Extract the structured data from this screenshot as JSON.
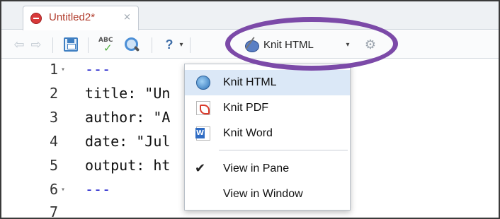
{
  "document_tab": {
    "title": "Untitled2*",
    "close_glyph": "×",
    "icon": "r-markdown-file-icon"
  },
  "toolbar": {
    "back_glyph": "⇦",
    "forward_glyph": "⇨",
    "spell_text": "ABC",
    "spell_check_glyph": "✓",
    "help_glyph": "?",
    "help_caret": "▾",
    "knit_label": "Knit HTML",
    "knit_caret": "▾",
    "settings_glyph": "⚙"
  },
  "editor": {
    "lines": [
      {
        "number": "1",
        "fold": "▾",
        "text": "---"
      },
      {
        "number": "2",
        "fold": "",
        "text": "title: \"Un"
      },
      {
        "number": "3",
        "fold": "",
        "text": "author: \"A"
      },
      {
        "number": "4",
        "fold": "",
        "text": "date: \"Jul"
      },
      {
        "number": "5",
        "fold": "",
        "text": "output: ht"
      },
      {
        "number": "6",
        "fold": "▾",
        "text": "---"
      },
      {
        "number": "7",
        "fold": "",
        "text": ""
      }
    ]
  },
  "knit_menu": {
    "items": [
      {
        "label": "Knit HTML",
        "icon": "globe-icon",
        "highlighted": true
      },
      {
        "label": "Knit PDF",
        "icon": "pdf-icon"
      },
      {
        "label": "Knit Word",
        "icon": "word-icon"
      },
      {
        "label": "View in Pane",
        "checked": true,
        "check_glyph": "✔"
      },
      {
        "label": "View in Window",
        "checked": false
      }
    ]
  },
  "colors": {
    "highlight_ring": "#7c4aa8",
    "menu_highlight": "#dbe8f7",
    "yaml_dash": "#2222cc"
  }
}
